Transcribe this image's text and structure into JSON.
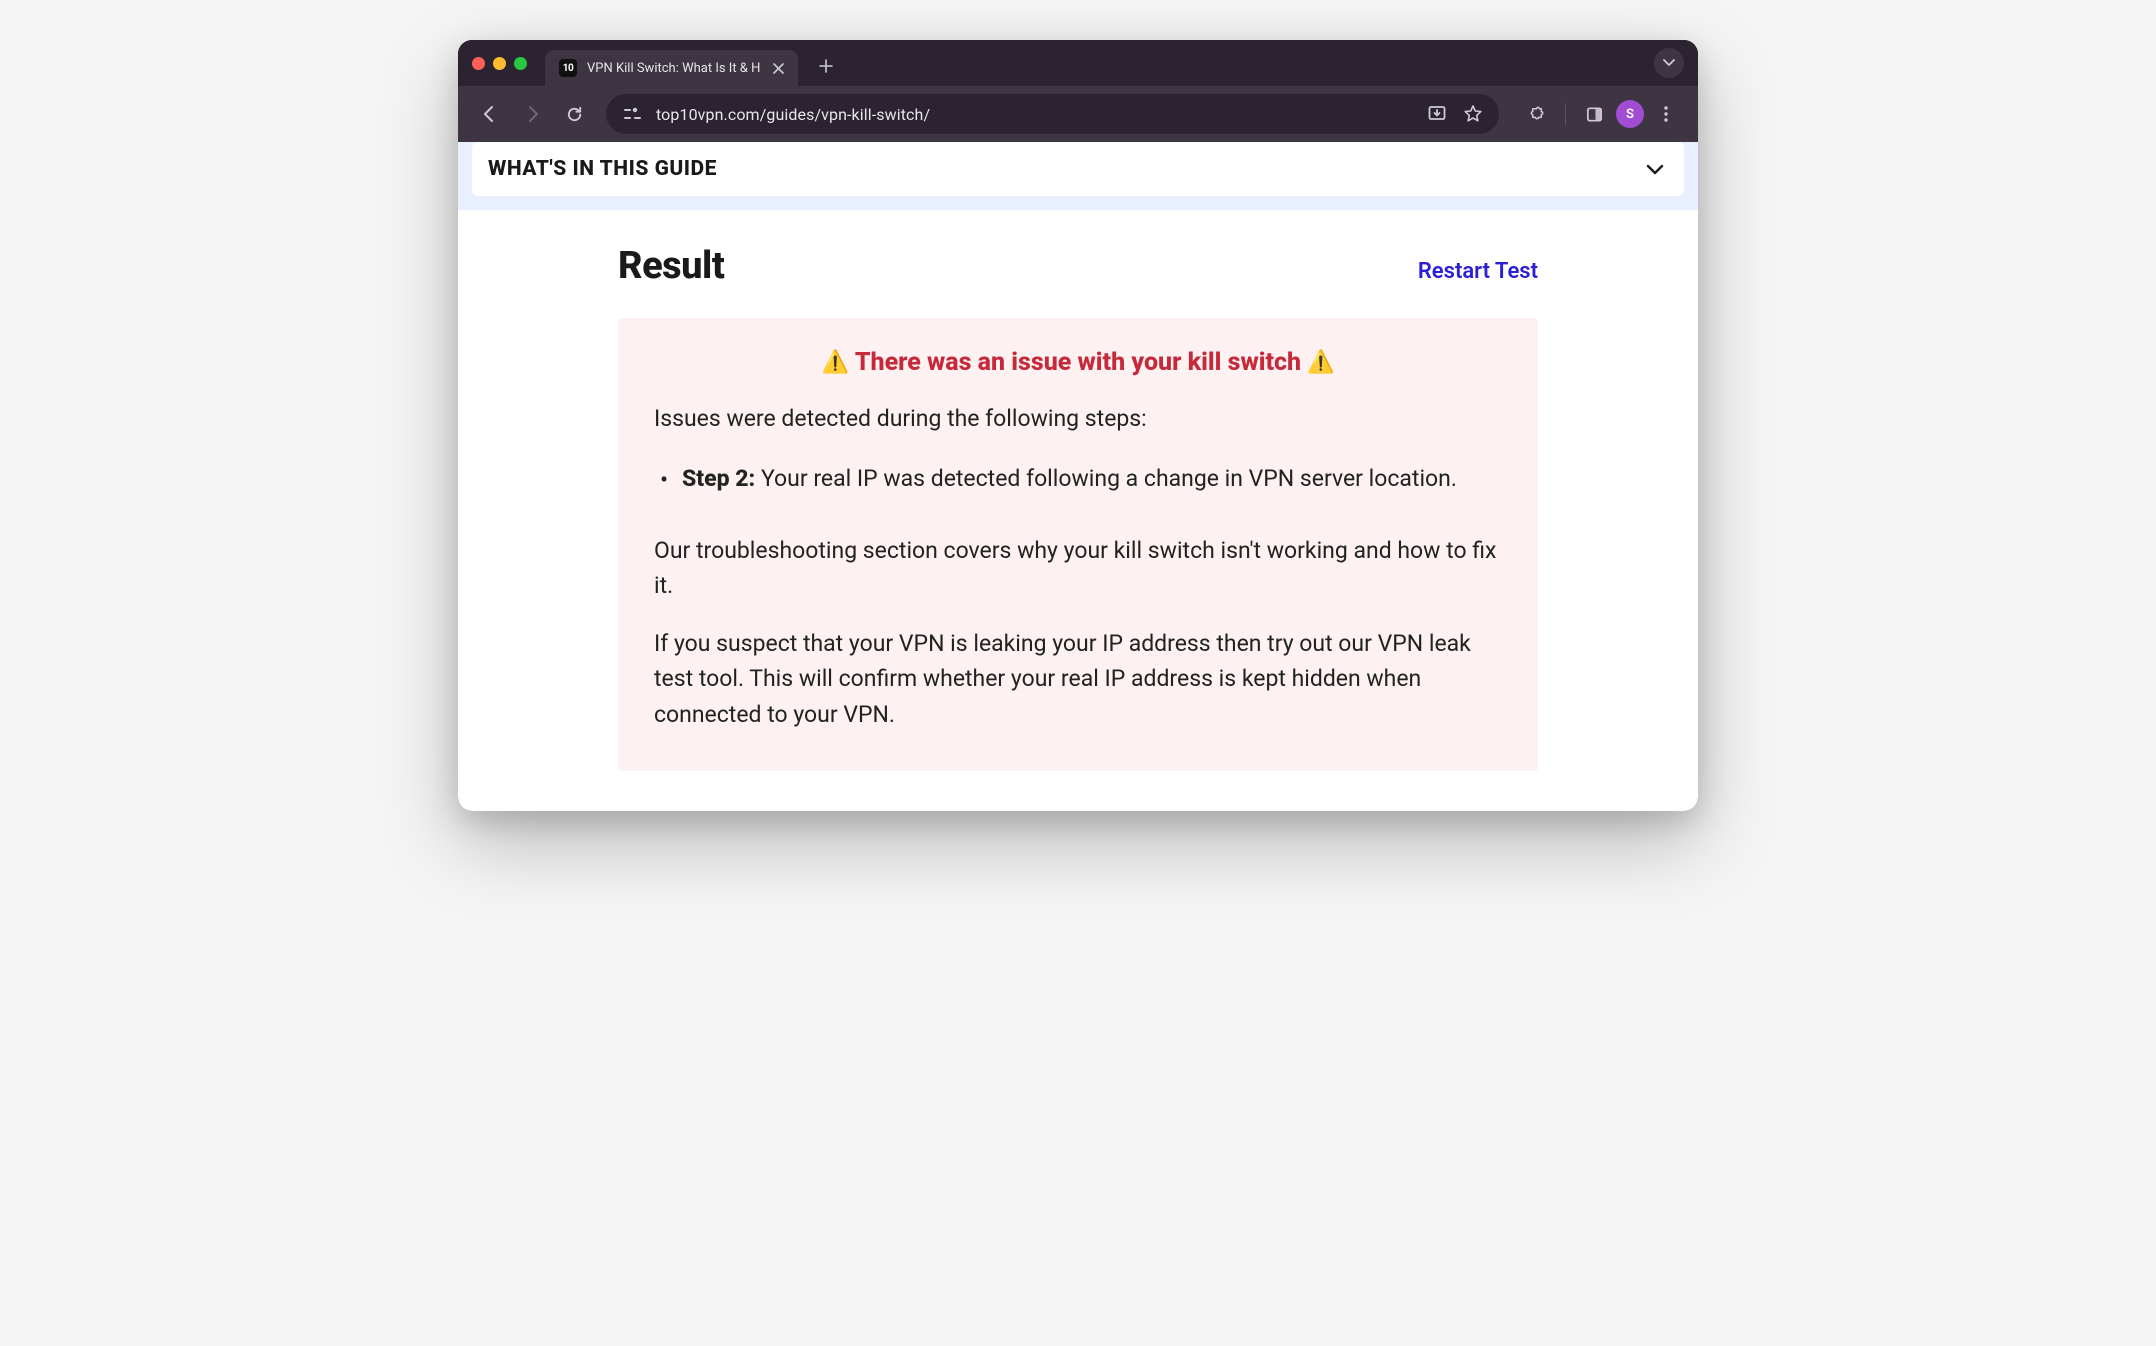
{
  "browser": {
    "tab": {
      "favicon_text": "10",
      "title": "VPN Kill Switch: What Is It & H"
    },
    "url": "top10vpn.com/guides/vpn-kill-switch/",
    "avatar_initial": "S"
  },
  "guide_bar": {
    "title": "WHAT'S IN THIS GUIDE"
  },
  "result": {
    "heading": "Result",
    "restart_label": "Restart Test",
    "warning_text": "There was an issue with your kill switch",
    "issues_intro": "Issues were detected during the following steps:",
    "issues": [
      {
        "step_label": "Step 2:",
        "text": " Your real IP was detected following a change in VPN server location."
      }
    ],
    "paragraphs": [
      "Our troubleshooting section covers why your kill switch isn't working and how to fix it.",
      "If you suspect that your VPN is leaking your IP address then try out our VPN leak test tool. This will confirm whether your real IP address is kept hidden when connected to your VPN."
    ]
  }
}
